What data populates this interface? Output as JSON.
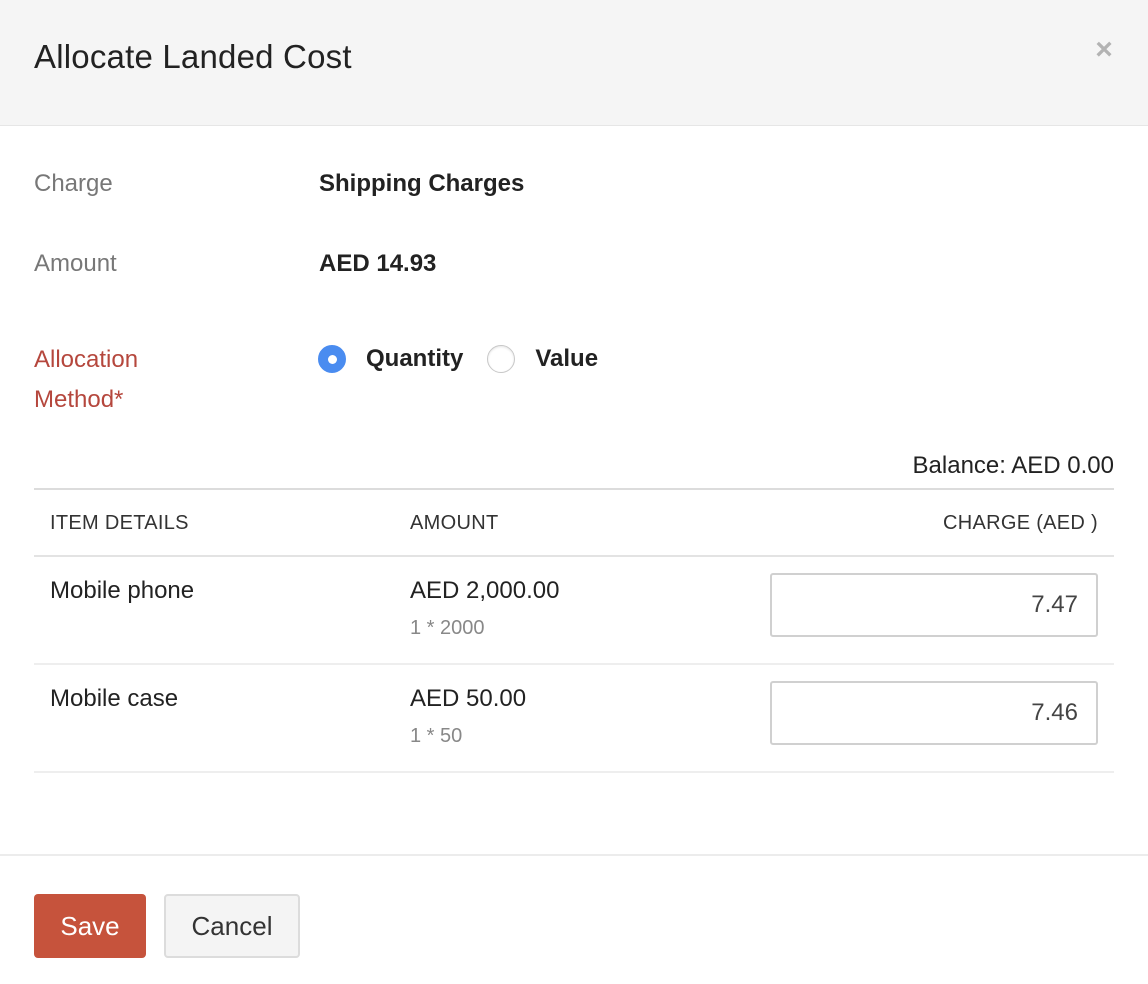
{
  "dialog": {
    "title": "Allocate Landed Cost",
    "close_icon": "×"
  },
  "fields": {
    "charge_label": "Charge",
    "charge_value": "Shipping Charges",
    "amount_label": "Amount",
    "amount_value": "AED 14.93",
    "allocation_label_line1": "Allocation",
    "allocation_label_line2": "Method*",
    "allocation_options": [
      {
        "label": "Quantity",
        "checked": true
      },
      {
        "label": "Value",
        "checked": false
      }
    ]
  },
  "balance": "Balance: AED 0.00",
  "table": {
    "headers": {
      "item": "ITEM DETAILS",
      "amount": "AMOUNT",
      "charge": "CHARGE (AED )"
    },
    "rows": [
      {
        "item": "Mobile phone",
        "amount": "AED 2,000.00",
        "sub": "1 * 2000",
        "charge": "7.47"
      },
      {
        "item": "Mobile case",
        "amount": "AED 50.00",
        "sub": "1 * 50",
        "charge": "7.46"
      }
    ]
  },
  "footer": {
    "save_label": "Save",
    "cancel_label": "Cancel"
  },
  "colors": {
    "accent_blue": "#4a8cf0",
    "save_red": "#c6533c",
    "required_red": "#b5473d"
  }
}
